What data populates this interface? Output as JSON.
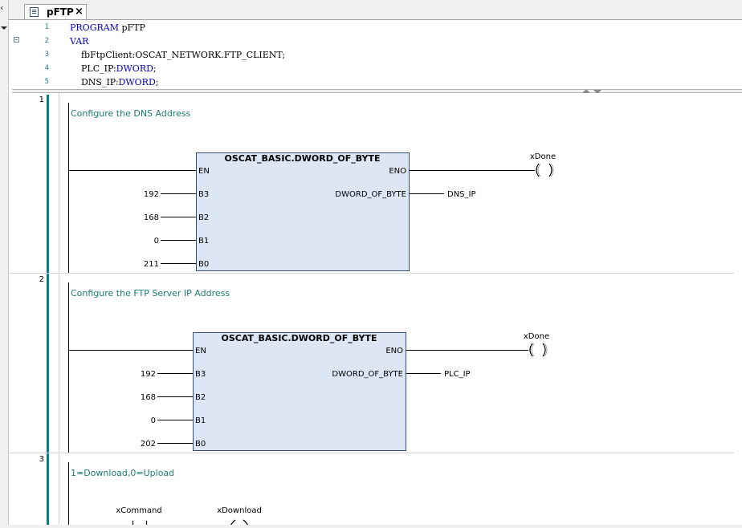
{
  "tab": {
    "title": "pFTP",
    "close": "×"
  },
  "declaration": {
    "lines": [
      {
        "num": "1",
        "parts": [
          {
            "t": "PROGRAM",
            "kw": true
          },
          {
            "t": " pFTP",
            "kw": false
          }
        ]
      },
      {
        "num": "2",
        "parts": [
          {
            "t": "VAR",
            "kw": true
          }
        ]
      },
      {
        "num": "3",
        "parts": [
          {
            "t": "    fbFtpClient:OSCAT_NETWORK.FTP_CLIENT;",
            "kw": false
          }
        ]
      },
      {
        "num": "4",
        "parts": [
          {
            "t": "    PLC_IP:",
            "kw": false
          },
          {
            "t": "DWORD",
            "kw": true
          },
          {
            "t": ";",
            "kw": false
          }
        ]
      },
      {
        "num": "5",
        "parts": [
          {
            "t": "    DNS_IP:",
            "kw": false
          },
          {
            "t": "DWORD",
            "kw": true
          },
          {
            "t": ";",
            "kw": false
          }
        ]
      }
    ]
  },
  "networks": [
    {
      "number": "1",
      "comment": "Configure the DNS Address",
      "block": {
        "name": "OSCAT_BASIC.DWORD_OF_BYTE",
        "inputs": [
          {
            "pin": "EN",
            "value": ""
          },
          {
            "pin": "B3",
            "value": "192"
          },
          {
            "pin": "B2",
            "value": "168"
          },
          {
            "pin": "B1",
            "value": "0"
          },
          {
            "pin": "B0",
            "value": "211"
          }
        ],
        "outputs": [
          {
            "pin": "ENO",
            "target": ""
          },
          {
            "pin": "DWORD_OF_BYTE",
            "target": "DNS_IP"
          }
        ]
      },
      "coil": "xDone"
    },
    {
      "number": "2",
      "comment": "Configure the FTP Server IP Address",
      "block": {
        "name": "OSCAT_BASIC.DWORD_OF_BYTE",
        "inputs": [
          {
            "pin": "EN",
            "value": ""
          },
          {
            "pin": "B3",
            "value": "192"
          },
          {
            "pin": "B2",
            "value": "168"
          },
          {
            "pin": "B1",
            "value": "0"
          },
          {
            "pin": "B0",
            "value": "202"
          }
        ],
        "outputs": [
          {
            "pin": "ENO",
            "target": ""
          },
          {
            "pin": "DWORD_OF_BYTE",
            "target": "PLC_IP"
          }
        ]
      },
      "coil": "xDone"
    },
    {
      "number": "3",
      "comment": "1=Download,0=Upload",
      "contact": "xCommand",
      "coil": "xDownload"
    }
  ],
  "colors": {
    "rail": "#008080",
    "comment": "#1c7a7a",
    "block_fill": "#dde6f4",
    "block_border": "#2f4f7f",
    "keyword": "#0000c0"
  }
}
